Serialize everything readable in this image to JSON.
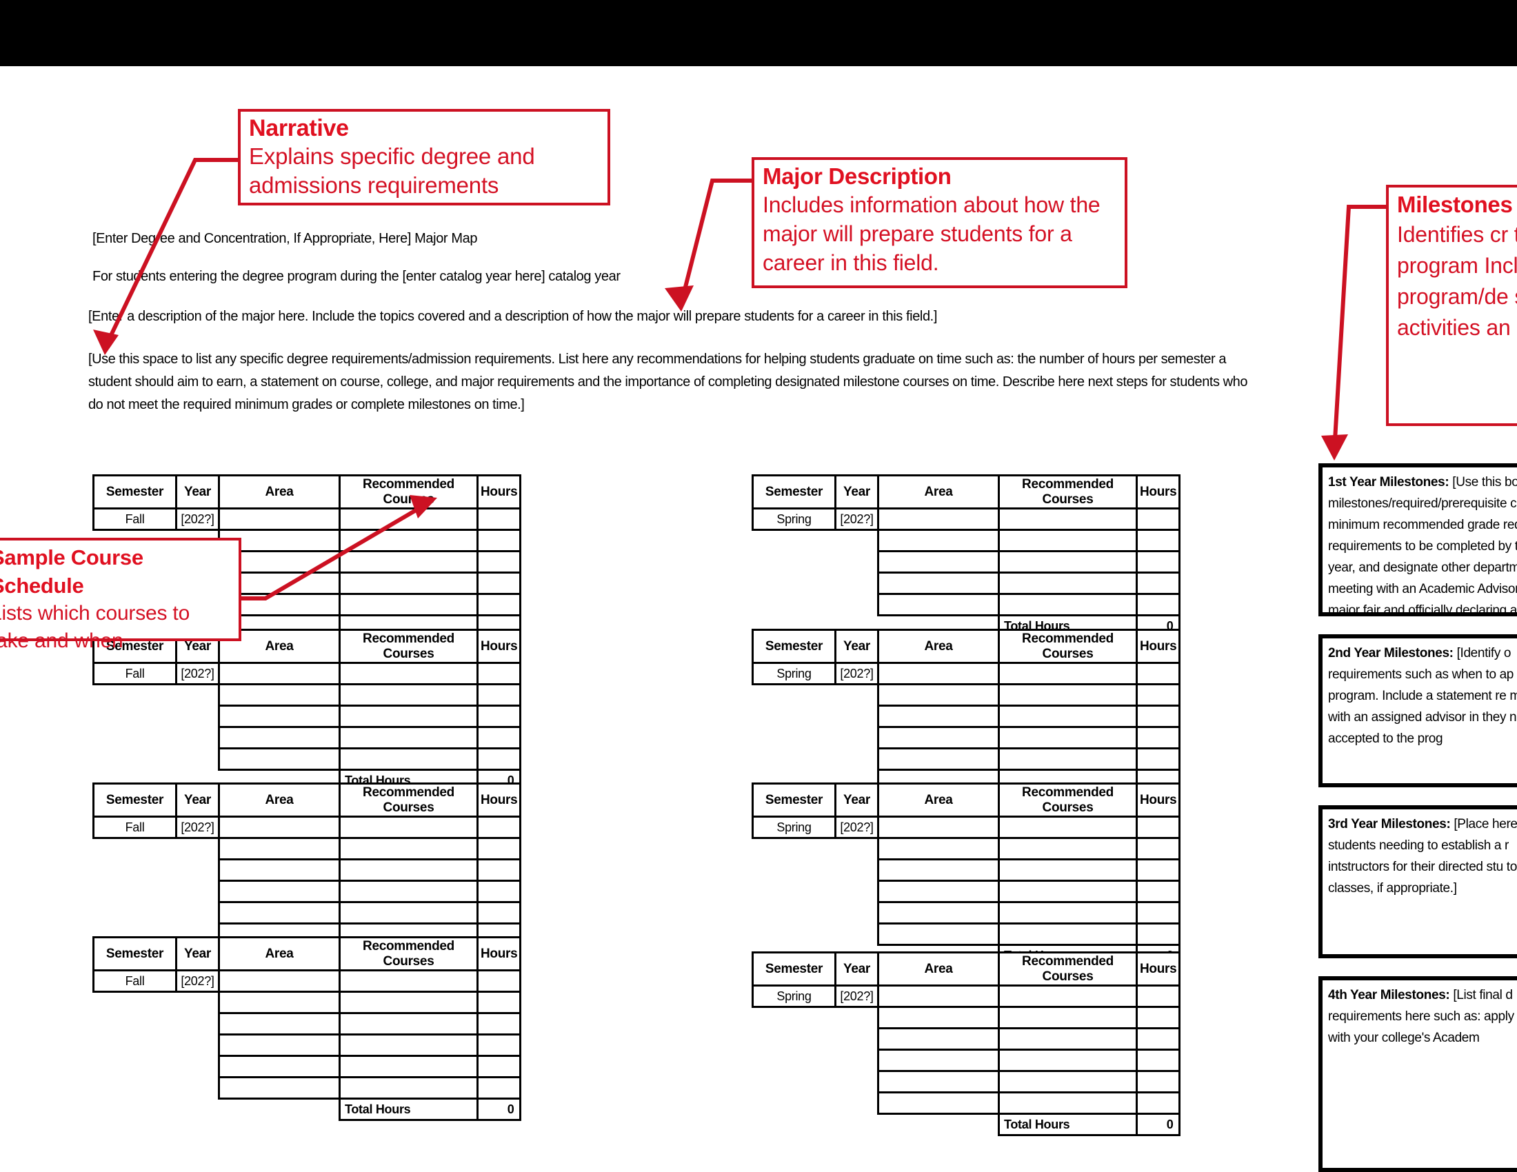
{
  "document": {
    "title_line": "[Enter Degree and Concentration, If Appropriate, Here] Major Map",
    "catalog_line": "For students entering the degree program during the [enter catalog year here] catalog year",
    "description_line": "[Enter a description of the major here. Include the topics covered and a description of how the major will prepare students for a career in this field.]",
    "requirements_para": "[Use this space to list any specific degree requirements/admission requirements. List here any recommendations for helping students graduate on time such as: the number of hours per semester a student should aim to earn, a statement on course, college, and major requirements and the importance of completing designated milestone courses on time. Describe here next steps for students who do not meet the required minimum grades or complete milestones on time.]"
  },
  "callouts": {
    "narrative": {
      "title": "Narrative",
      "body": "Explains specific degree and admissions requirements"
    },
    "major": {
      "title": "Major Description",
      "body": "Includes information about how the major will prepare students for a career in this field."
    },
    "milestones": {
      "title": "Milestones",
      "body": "Identifies cr their minimu to program Includes no program/de such as care activities an"
    },
    "sample": {
      "title": "Sample Course Schedule",
      "body": "Lists which courses to take and when"
    }
  },
  "table": {
    "headers": {
      "semester": "Semester",
      "year": "Year",
      "area": "Area",
      "recommended": "Recommended Courses",
      "hours": "Hours"
    },
    "total_label": "Total Hours",
    "total_value": "0",
    "year_value": "[202?]",
    "fall": "Fall",
    "spring": "Spring"
  },
  "schedule_blocks": [
    {
      "id": "y1-fall",
      "semester": "Fall",
      "year": "[202?]",
      "empty_rows": 5,
      "total_label": "Total Hours",
      "total_value": "0"
    },
    {
      "id": "y1-spring",
      "semester": "Spring",
      "year": "[202?]",
      "empty_rows": 4,
      "total_label": "Total Hours",
      "total_value": "0"
    },
    {
      "id": "y2-fall",
      "semester": "Fall",
      "year": "[202?]",
      "empty_rows": 4,
      "total_label": "Total Hours",
      "total_value": "0"
    },
    {
      "id": "y2-spring",
      "semester": "Spring",
      "year": "[202?]",
      "empty_rows": 5,
      "total_label": "Total Hours",
      "total_value": "0"
    },
    {
      "id": "y3-fall",
      "semester": "Fall",
      "year": "[202?]",
      "empty_rows": 5,
      "total_label": "Total Hours",
      "total_value": "0"
    },
    {
      "id": "y3-spring",
      "semester": "Spring",
      "year": "[202?]",
      "empty_rows": 5,
      "total_label": "Total Hours",
      "total_value": "0"
    },
    {
      "id": "y4-fall",
      "semester": "Fall",
      "year": "[202?]",
      "empty_rows": 5,
      "total_label": "Total Hours",
      "total_value": "0"
    },
    {
      "id": "y4-spring",
      "semester": "Spring",
      "year": "[202?]",
      "empty_rows": 5,
      "total_label": "Total Hours",
      "total_value": "0"
    }
  ],
  "milestones": [
    {
      "label": "1st Year Milestones:",
      "text": " [Use this box t milestones/required/prerequisite c minimum recommended grade requ requirements to be completed by th year, and designate other departme meeting with an Academic Advisor, major fair and officially declaring a"
    },
    {
      "label": "2nd Year Milestones:",
      "text": " [Identify o requirements such as when to ap program.  Include a statement re meet with an assigned advisor in they not be accepted to the prog"
    },
    {
      "label": "3rd Year Milestones:",
      "text": " [Place here students needing to establish a r intstructors for their directed stu topics classes, if appropriate.]"
    },
    {
      "label": "4th Year Milestones:",
      "text": " [List final d requirements here such as: apply meet with your college's Academ"
    }
  ],
  "colors": {
    "callout_red": "#d41124",
    "callout_border": "#cc1122",
    "table_border": "#000000",
    "band": "#000000"
  }
}
